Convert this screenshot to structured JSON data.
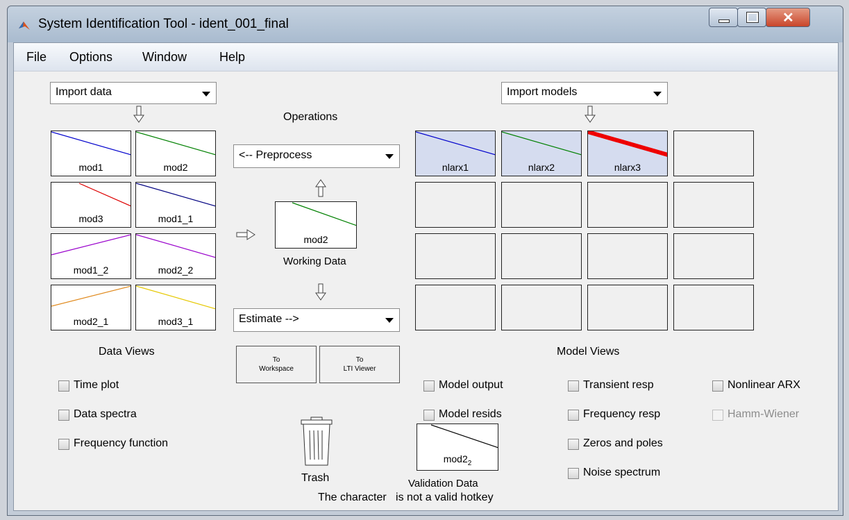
{
  "window": {
    "title": "System Identification Tool - ident_001_final"
  },
  "menu": {
    "items": [
      "File",
      "Options",
      "Window",
      "Help"
    ]
  },
  "data_panel": {
    "import_select": "Import data",
    "tiles": [
      {
        "label": "mod1",
        "color": "#0000cc"
      },
      {
        "label": "mod2",
        "color": "#008000"
      },
      {
        "label": "mod3",
        "color": "#dd0000"
      },
      {
        "label": "mod1_1",
        "color": "#000080"
      },
      {
        "label": "mod1_2",
        "color": "#9900cc"
      },
      {
        "label": "mod2_2",
        "color": "#9900cc"
      },
      {
        "label": "mod2_1",
        "color": "#e08a1e"
      },
      {
        "label": "mod3_1",
        "color": "#e6c800"
      }
    ],
    "heading": "Data Views",
    "checks": [
      "Time plot",
      "Data spectra",
      "Frequency function"
    ]
  },
  "operations": {
    "heading": "Operations",
    "preprocess": "<-- Preprocess",
    "working": {
      "label": "mod2",
      "caption": "Working Data",
      "color": "#008000"
    },
    "estimate": "Estimate -->",
    "to_workspace": [
      "To",
      "Workspace"
    ],
    "to_lti": [
      "To",
      "LTI Viewer"
    ],
    "trash": "Trash"
  },
  "models_panel": {
    "import_select": "Import models",
    "tiles": [
      {
        "label": "nlarx1",
        "color": "#0000cc"
      },
      {
        "label": "nlarx2",
        "color": "#008000"
      },
      {
        "label": "nlarx3",
        "color": "#ee0000"
      }
    ],
    "heading": "Model Views",
    "checks": {
      "col1": [
        "Model output",
        "Model resids"
      ],
      "col2": [
        "Transient resp",
        "Frequency resp",
        "Zeros and poles",
        "Noise spectrum"
      ],
      "col3": [
        "Nonlinear ARX",
        "Hamm-Wiener"
      ]
    }
  },
  "validation": {
    "label": "mod2",
    "subscript": "2",
    "caption": "Validation Data"
  },
  "status": {
    "message": "The character   is not a valid hotkey"
  }
}
